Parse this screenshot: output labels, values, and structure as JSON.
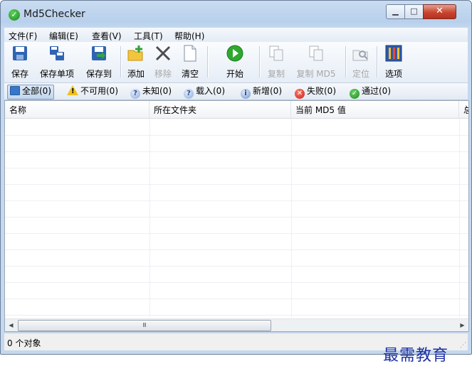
{
  "window": {
    "title": "Md5Checker"
  },
  "menu": [
    "文件(F)",
    "编辑(E)",
    "查看(V)",
    "工具(T)",
    "帮助(H)"
  ],
  "toolbar": [
    {
      "label": "保存",
      "icon": "save-icon"
    },
    {
      "label": "保存单项",
      "icon": "save-single-icon"
    },
    {
      "label": "保存到",
      "icon": "save-to-icon"
    },
    {
      "label": "添加",
      "icon": "add-folder-icon"
    },
    {
      "label": "移除",
      "icon": "remove-icon"
    },
    {
      "label": "清空",
      "icon": "clear-icon"
    },
    {
      "label": "开始",
      "icon": "play-icon"
    },
    {
      "label": "复制",
      "icon": "copy-icon"
    },
    {
      "label": "复制 MD5",
      "icon": "copy-md5-icon"
    },
    {
      "label": "定位",
      "icon": "locate-icon"
    },
    {
      "label": "选项",
      "icon": "options-icon"
    }
  ],
  "filters": [
    "全部(0)",
    "不可用(0)",
    "未知(0)",
    "载入(0)",
    "新增(0)",
    "失败(0)",
    "通过(0)"
  ],
  "columns": [
    "名称",
    "所在文件夹",
    "当前 MD5 值",
    "总"
  ],
  "scrollbar": {
    "thumb": "Ⅲ"
  },
  "status": "0 个对象",
  "watermark": "最需教育",
  "colors": {
    "accent": "#3877c7",
    "ok": "#1d8a21",
    "error": "#c8221a",
    "warning": "#f2c11a"
  }
}
